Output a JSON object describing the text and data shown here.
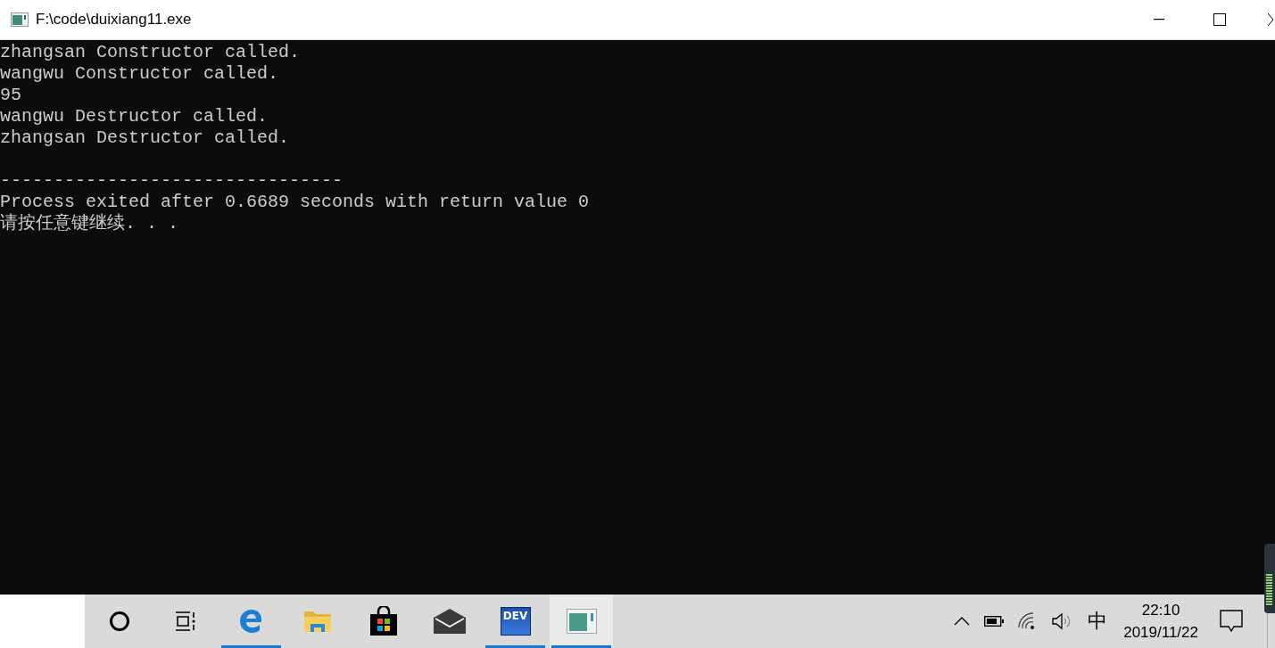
{
  "window": {
    "title": "F:\\code\\duixiang11.exe"
  },
  "console": {
    "blocks": [
      [
        "zhangsan Constructor called.",
        "wangwu Constructor called.",
        "95",
        "wangwu Destructor called.",
        "zhangsan Destructor called."
      ],
      [
        "--------------------------------",
        "Process exited after 0.6689 seconds with return value 0",
        "请按任意键继续. . ."
      ]
    ]
  },
  "taskbar": {
    "apps": [
      {
        "kind": "cortana",
        "running": false,
        "selected": false
      },
      {
        "kind": "taskview",
        "running": false,
        "selected": false
      },
      {
        "kind": "edge",
        "running": true,
        "selected": false
      },
      {
        "kind": "explorer",
        "running": false,
        "selected": false
      },
      {
        "kind": "store",
        "running": false,
        "selected": false
      },
      {
        "kind": "mail",
        "running": false,
        "selected": false
      },
      {
        "kind": "devcpp",
        "label": "DEV",
        "running": true,
        "selected": false
      },
      {
        "kind": "console",
        "running": true,
        "selected": true
      }
    ],
    "tray": {
      "input_method": "中",
      "time": "22:10",
      "date": "2019/11/22"
    }
  }
}
